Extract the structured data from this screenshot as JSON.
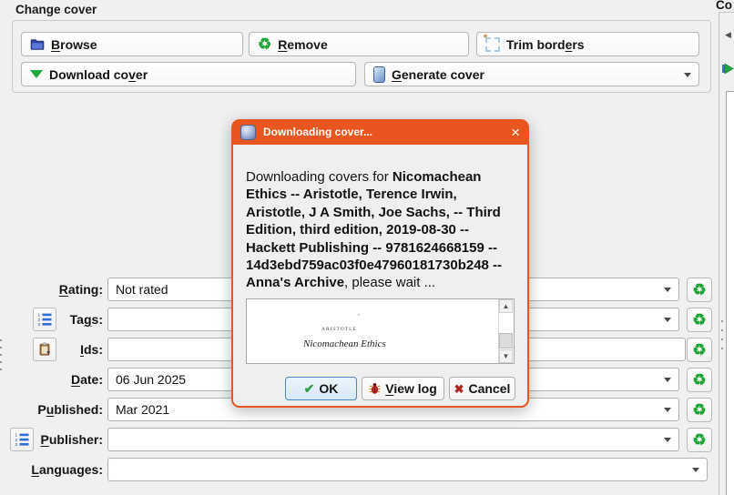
{
  "change_cover": {
    "heading": "Change cover",
    "buttons": {
      "browse": {
        "pre": "",
        "accel": "B",
        "post": "rowse"
      },
      "remove": {
        "pre": "",
        "accel": "R",
        "post": "emove"
      },
      "trim_borders": {
        "pre": "Trim bord",
        "accel": "e",
        "post": "rs"
      },
      "download_cover": {
        "pre": "Download co",
        "accel": "v",
        "post": "er"
      },
      "generate_cover": {
        "pre": "",
        "accel": "G",
        "post": "enerate cover"
      }
    }
  },
  "form": {
    "rating": {
      "label": {
        "pre": "",
        "accel": "R",
        "post": "ating:"
      },
      "value": "Not rated"
    },
    "tags": {
      "label": {
        "pre": "Ta",
        "accel": "g",
        "post": "s:"
      },
      "value": ""
    },
    "ids": {
      "label": {
        "pre": "",
        "accel": "I",
        "post": "ds:"
      },
      "value": ""
    },
    "date": {
      "label": {
        "pre": "",
        "accel": "D",
        "post": "ate:"
      },
      "value": "06 Jun 2025"
    },
    "published": {
      "label": {
        "pre": "P",
        "accel": "u",
        "post": "blished:"
      },
      "value": "Mar 2021"
    },
    "publisher": {
      "label": {
        "pre": "",
        "accel": "P",
        "post": "ublisher:"
      },
      "value": ""
    },
    "languages": {
      "label": {
        "pre": "",
        "accel": "L",
        "post": "anguages:"
      },
      "value": ""
    }
  },
  "dialog": {
    "title": "Downloading cover...",
    "message": {
      "prefix": "Downloading covers for ",
      "bold": "Nicomachean Ethics -- Aristotle, Terence Irwin, Aristotle, J A Smith, Joe Sachs, -- Third Edition, third edition, 2019-08-30 -- Hackett Publishing -- 9781624668159 -- 14d3ebd759ac03f0e47960181730b248 -- Anna's Archive",
      "suffix": ", please wait ..."
    },
    "cover_preview": {
      "author": "ARISTOTLE",
      "title": "Nicomachean Ethics"
    },
    "buttons": {
      "ok": {
        "pre": "",
        "accel": "",
        "post": "OK"
      },
      "view_log": {
        "pre": "",
        "accel": "V",
        "post": "iew log"
      },
      "cancel": {
        "pre": "",
        "accel": "",
        "post": "Cancel"
      }
    }
  },
  "right_panel": {
    "heading_clipped": "Co"
  },
  "icons": {
    "recycle": "♻",
    "check": "✔",
    "cross": "✖",
    "close": "×",
    "scroll_up": "▲",
    "scroll_down": "▼",
    "left_arrow": "◀",
    "trim_star": "*",
    "cover_dash": "-"
  },
  "colors": {
    "titlebar_orange": "#e8551f",
    "recycle_green": "#1ea434",
    "download_green": "#21a83c",
    "ok_border_blue": "#4b87c2"
  }
}
